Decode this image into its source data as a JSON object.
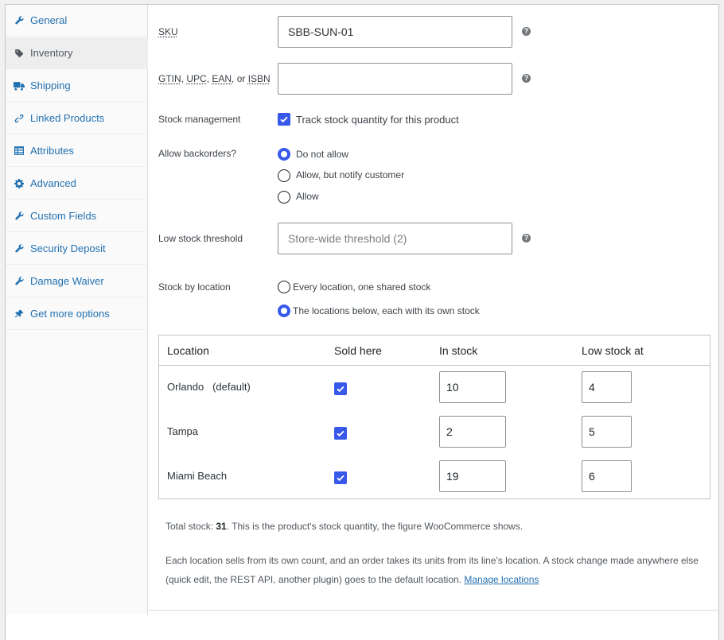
{
  "tabs": [
    {
      "label": "General",
      "icon": "wrench-icon"
    },
    {
      "label": "Inventory",
      "icon": "tag-icon",
      "active": true
    },
    {
      "label": "Shipping",
      "icon": "truck-icon"
    },
    {
      "label": "Linked Products",
      "icon": "link-icon"
    },
    {
      "label": "Attributes",
      "icon": "table-icon"
    },
    {
      "label": "Advanced",
      "icon": "gear-icon"
    },
    {
      "label": "Custom Fields",
      "icon": "wrench-icon"
    },
    {
      "label": "Security Deposit",
      "icon": "wrench-icon"
    },
    {
      "label": "Damage Waiver",
      "icon": "wrench-icon"
    },
    {
      "label": "Get more options",
      "icon": "plugin-icon"
    }
  ],
  "sku": {
    "label": "SKU",
    "value": "SBB-SUN-01"
  },
  "gtin": {
    "label_parts": [
      "GTIN",
      "UPC",
      "EAN",
      "ISBN"
    ],
    "sep1": ", ",
    "sep2": ", ",
    "sep3": ", or ",
    "value": ""
  },
  "stock_management": {
    "label": "Stock management",
    "checkbox_label": "Track stock quantity for this product",
    "checked": true
  },
  "backorders": {
    "label": "Allow backorders?",
    "options": [
      {
        "label": "Do not allow",
        "selected": true
      },
      {
        "label": "Allow, but notify customer",
        "selected": false
      },
      {
        "label": "Allow",
        "selected": false
      }
    ]
  },
  "low_stock": {
    "label": "Low stock threshold",
    "placeholder": "Store-wide threshold (2)"
  },
  "stock_by_location": {
    "label": "Stock by location",
    "options": [
      {
        "label": "Every location, one shared stock",
        "selected": false
      },
      {
        "label": "The locations below, each with its own stock",
        "selected": true
      }
    ]
  },
  "locations_table": {
    "headers": [
      "Location",
      "Sold here",
      "In stock",
      "Low stock at"
    ],
    "rows": [
      {
        "name": "Orlando",
        "tag": "(default)",
        "sold_here": true,
        "in_stock": "10",
        "low_stock": "4"
      },
      {
        "name": "Tampa",
        "tag": "",
        "sold_here": true,
        "in_stock": "2",
        "low_stock": "5"
      },
      {
        "name": "Miami Beach",
        "tag": "",
        "sold_here": true,
        "in_stock": "19",
        "low_stock": "6"
      }
    ]
  },
  "total_note": {
    "prefix": "Total stock: ",
    "value": "31",
    "suffix": ". This is the product's stock quantity, the figure WooCommerce shows."
  },
  "location_note": {
    "text": "Each location sells from its own count, and an order takes its units from its line's location. A stock change made anywhere else (quick edit, the REST API, another plugin) goes to the default location. ",
    "link": "Manage locations"
  },
  "colors": {
    "accent": "#3858e9",
    "link": "#2271b1",
    "border": "#c3c4c7"
  }
}
